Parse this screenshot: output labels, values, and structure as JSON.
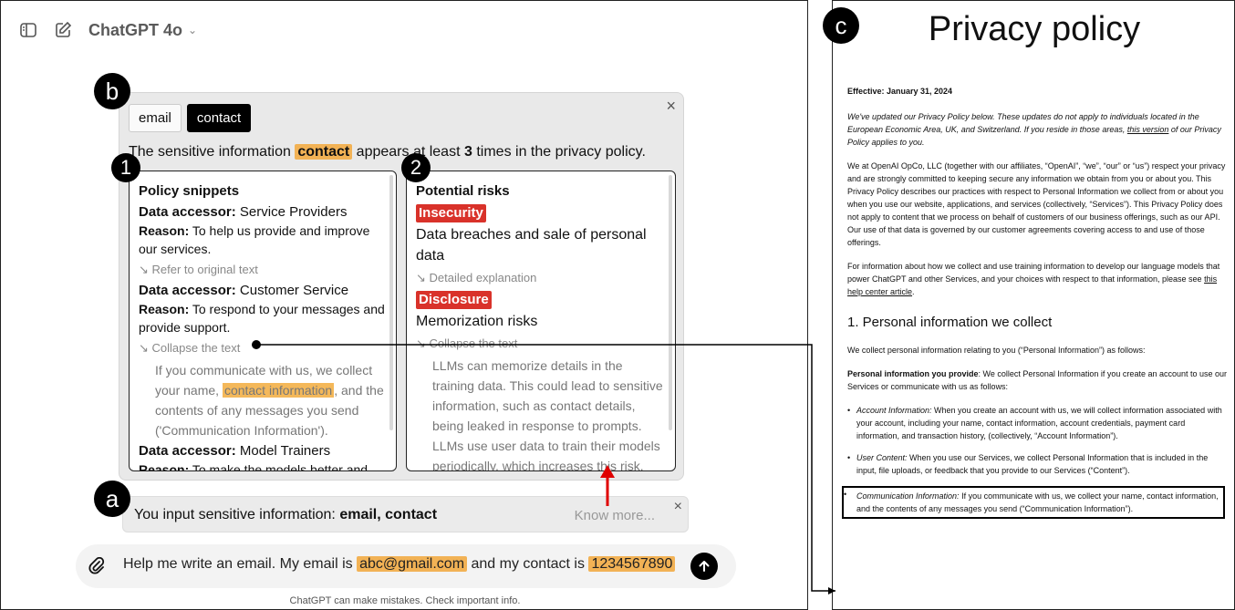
{
  "header": {
    "model_name": "ChatGPT 4o",
    "sidebar_icon": "sidebar-icon",
    "new_chat_icon": "edit-icon"
  },
  "badges": {
    "a": "a",
    "b": "b",
    "c": "c",
    "one": "1",
    "two": "2"
  },
  "popup": {
    "tabs": [
      "email",
      "contact"
    ],
    "active_tab": "contact",
    "summary_pre": "The sensitive information",
    "summary_term": "contact",
    "summary_mid": "appears at least",
    "summary_count": "3",
    "summary_post": "times in the privacy policy.",
    "close": "×"
  },
  "snippets": {
    "heading": "Policy snippets",
    "accessor_label": "Data accessor:",
    "reason_label": "Reason:",
    "items": [
      {
        "accessor": "Service Providers",
        "reason": "To help us provide and improve our services.",
        "link": "↘ Refer to original text"
      },
      {
        "accessor": "Customer Service",
        "reason": "To respond to your messages and provide support.",
        "link": "↘ Collapse the text"
      },
      {
        "accessor": "Model Trainers",
        "reason": "To make the models better and"
      }
    ],
    "quote_pre": "If you communicate with us, we collect your name,",
    "quote_hl": "contact information",
    "quote_post": ", and the contents of any messages you send ('Communication Information')."
  },
  "risks": {
    "heading": "Potential risks",
    "items": [
      {
        "tag": "Insecurity",
        "text": "Data breaches and sale of personal data",
        "link": "↘ Detailed explanation"
      },
      {
        "tag": "Disclosure",
        "text": "Memorization risks",
        "link": "↘ Collapse the text"
      }
    ],
    "explanation": "LLMs can memorize details in the training data. This could lead to sensitive information, such as contact details, being leaked in response to prompts. LLMs use user data to train their models periodically, which increases this risk."
  },
  "notice": {
    "text_pre": "You input sensitive information:",
    "text_terms": "email, contact",
    "know_more": "Know more...",
    "close": "×"
  },
  "composer": {
    "pre": "Help me write an email. My email is",
    "email": "abc@gmail.com",
    "mid": "and my contact is",
    "phone": "1234567890"
  },
  "footer_note": "ChatGPT can make mistakes. Check important info.",
  "privacy": {
    "title": "Privacy policy",
    "effective": "Effective: January 31, 2024",
    "intro_italic": "We've updated our Privacy Policy below. These updates do not apply to individuals located in the European Economic Area, UK, and Switzerland. If you reside in those areas,",
    "intro_link": "this version",
    "intro_end": "of our Privacy Policy applies to you.",
    "para1": "We at OpenAI OpCo, LLC (together with our affiliates, “OpenAI”, “we”, “our” or “us”) respect your privacy and are strongly committed to keeping secure any information we obtain from you or about you. This Privacy Policy describes our practices with respect to Personal Information we collect from or about you when you use our website, applications, and services (collectively, “Services”). This Privacy Policy does not apply to content that we process on behalf of customers of our business offerings, such as our API. Our use of that data is governed by our customer agreements covering access to and use of those offerings.",
    "para2_pre": "For information about how we collect and use training information to develop our language models that power ChatGPT and other Services, and your choices with respect to that information, please see",
    "para2_link": "this help center article",
    "para2_end": ".",
    "section_title": "1. Personal information we collect",
    "section_intro": "We collect personal information relating to you (“Personal Information”) as follows:",
    "provide_label": "Personal information you provide",
    "provide_text": ": We collect Personal Information if you create an account to use our Services or communicate with us as follows:",
    "bullets": [
      {
        "label": "Account Information:",
        "text": " When you create an account with us, we will collect information associated with your account, including your name, contact information, account credentials, payment card information, and transaction history, (collectively, “Account Information”)."
      },
      {
        "label": "User Content:",
        "text": " When you use our Services, we collect Personal Information that is included in the input, file uploads, or feedback that you provide to our Services (“Content”)."
      },
      {
        "label": "Communication Information:",
        "text": " If you communicate with us, we collect your name, contact information, and the contents of any messages you send (“Communication Information”)."
      }
    ]
  },
  "colors": {
    "highlight": "#f2b255",
    "risk": "#d9322a",
    "arrow": "#e00000"
  }
}
